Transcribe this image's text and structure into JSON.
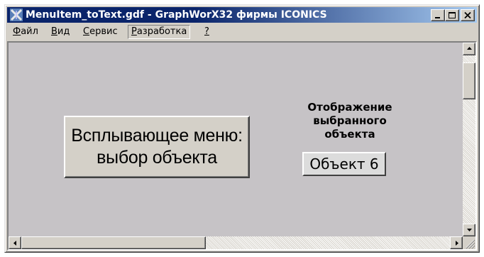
{
  "window": {
    "title": "MenuItem_toText.gdf - GraphWorX32 фирмы ICONICS",
    "titlebar_color": "#0a246a",
    "controls": [
      "minimize-icon",
      "maximize-icon",
      "close-icon"
    ]
  },
  "menubar": {
    "items": [
      {
        "accel": "Ф",
        "rest": "айл"
      },
      {
        "accel": "В",
        "rest": "ид"
      },
      {
        "accel": "С",
        "rest": "ервис"
      },
      {
        "accel": "Р",
        "rest": "азработка"
      },
      {
        "accel": "?",
        "rest": ""
      }
    ],
    "active_item": "Разработка"
  },
  "canvas": {
    "background": "#c6c3c6",
    "menu_button": {
      "line1": "Всплывающее меню:",
      "line2": "выбор объекта"
    },
    "display": {
      "label_line1": "Отображение",
      "label_line2": "выбранного",
      "label_line3": "объекта",
      "value": "Объект 6"
    }
  },
  "scrollbars": {
    "vertical_position": 0.1,
    "horizontal_position": 0.0
  }
}
